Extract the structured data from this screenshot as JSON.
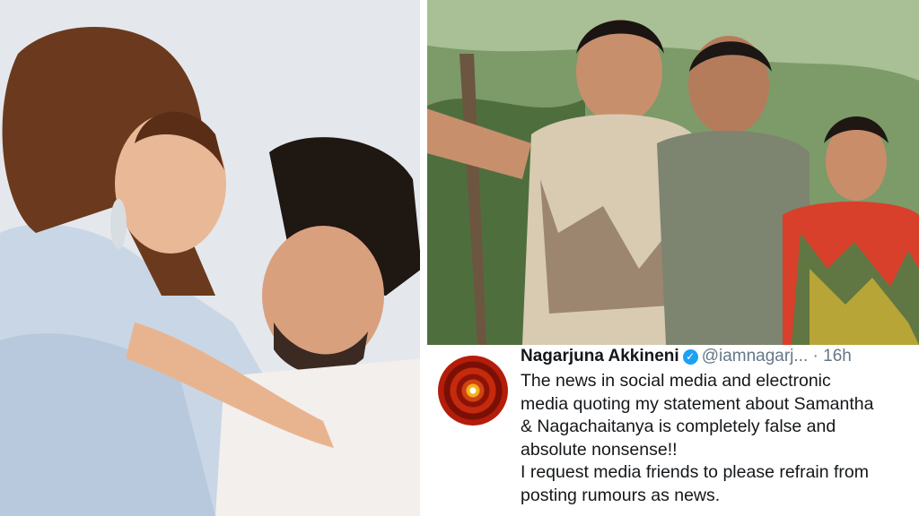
{
  "tweet": {
    "name": "Nagarjuna Akkineni",
    "verified_icon": "check",
    "handle": "@iamnagarj...",
    "separator": "·",
    "time": "16h",
    "lines": [
      "The news in social media and electronic",
      "media quoting my statement about Samantha",
      "& Nagachaitanya is completely false and",
      "absolute nonsense!!",
      "I request media friends to please refrain from",
      "posting rumours as news."
    ]
  },
  "colors": {
    "verified": "#1da1f2",
    "text": "#14171a",
    "muted": "#657786"
  }
}
